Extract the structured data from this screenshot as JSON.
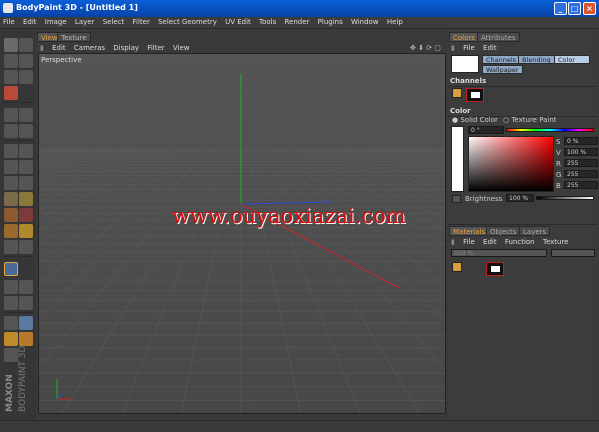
{
  "window": {
    "title": "BodyPaint 3D - [Untitled 1]",
    "controls": [
      "_",
      "□",
      "×"
    ]
  },
  "menu": [
    "File",
    "Edit",
    "Image",
    "Layer",
    "Select",
    "Filter",
    "Select Geometry",
    "UV Edit",
    "Tools",
    "Render",
    "Plugins",
    "Window",
    "Help"
  ],
  "viewport": {
    "tabs": [
      "View",
      "Texture"
    ],
    "menu": [
      "Edit",
      "Cameras",
      "Display",
      "Filter",
      "View"
    ],
    "label": "Perspective"
  },
  "brand": {
    "line1": "MAXON",
    "line2": "BODYPAINT 3D"
  },
  "watermark": "www.ouyaoxiazai.com",
  "colors_panel": {
    "tabs": [
      "Colors",
      "Attributes"
    ],
    "menu": [
      "File",
      "Edit"
    ],
    "mode_buttons": [
      "Channels",
      "Blending",
      "Color",
      "Wallpaper"
    ],
    "channels_title": "Channels",
    "color_title": "Color",
    "color_modes": [
      "Solid Color",
      "Texture Paint"
    ],
    "hue_value": "0 °",
    "sv_fields": [
      {
        "label": "S",
        "value": "0 %"
      },
      {
        "label": "V",
        "value": "100 %"
      },
      {
        "label": "R",
        "value": "255"
      },
      {
        "label": "G",
        "value": "255"
      },
      {
        "label": "B",
        "value": "255"
      }
    ],
    "brightness_label": "Brightness",
    "brightness_value": "100 %"
  },
  "materials_panel": {
    "tabs": [
      "Materials",
      "Objects",
      "Layers"
    ],
    "menu": [
      "File",
      "Edit",
      "Function",
      "Texture"
    ],
    "zoom_value": "100 %"
  },
  "colors": {
    "titlebar": "#0a4fc4",
    "accent_tab": "#e8a23c",
    "watermark": "#d90a0a",
    "axis_y": "#1fb31f",
    "axis_x": "#c8252a",
    "axis_z": "#2d4fd6"
  }
}
